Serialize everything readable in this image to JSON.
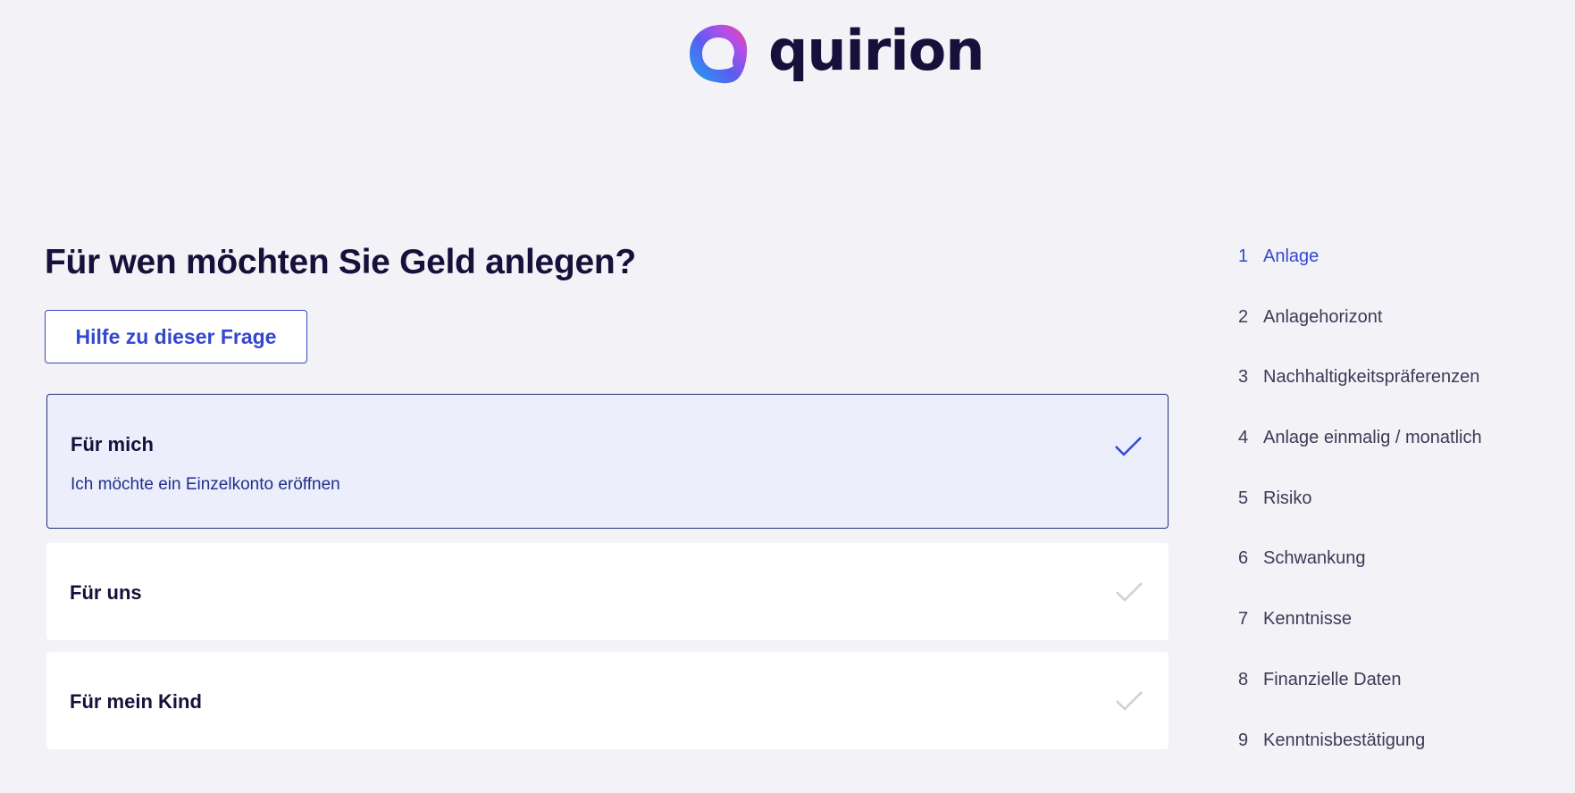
{
  "brand": {
    "name": "quirion"
  },
  "question": {
    "title": "Für wen möchten Sie Geld anlegen?",
    "help_label": "Hilfe zu dieser Frage"
  },
  "options": [
    {
      "title": "Für mich",
      "subtitle": "Ich möchte ein Einzelkonto eröffnen",
      "selected": true
    },
    {
      "title": "Für uns",
      "selected": false
    },
    {
      "title": "Für mein Kind",
      "selected": false
    }
  ],
  "steps": [
    {
      "number": "1",
      "label": "Anlage",
      "active": true
    },
    {
      "number": "2",
      "label": "Anlagehorizont",
      "active": false
    },
    {
      "number": "3",
      "label": "Nachhaltigkeitspräferenzen",
      "active": false
    },
    {
      "number": "4",
      "label": "Anlage einmalig / monatlich",
      "active": false
    },
    {
      "number": "5",
      "label": "Risiko",
      "active": false
    },
    {
      "number": "6",
      "label": "Schwankung",
      "active": false
    },
    {
      "number": "7",
      "label": "Kenntnisse",
      "active": false
    },
    {
      "number": "8",
      "label": "Finanzielle Daten",
      "active": false
    },
    {
      "number": "9",
      "label": "Kenntnisbestätigung",
      "active": false
    }
  ],
  "colors": {
    "background": "#f3f2f7",
    "accent": "#3447cf",
    "text_dark": "#17103a",
    "selected_bg": "#eceefc",
    "check_inactive": "#cfcfd6"
  }
}
